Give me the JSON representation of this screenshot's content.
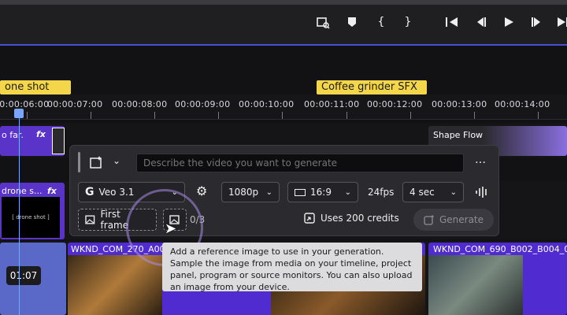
{
  "markers": {
    "left": "one shot",
    "right": "Coffee grinder SFX"
  },
  "ruler": [
    "00:00:06:00",
    "00:00:07:00",
    "00:00:08:00",
    "00:00:09:00",
    "00:00:10:00",
    "00:00:11:00",
    "00:00:12:00",
    "00:00:13:00",
    "00:00:14:00"
  ],
  "clips": {
    "top_left": "o far.",
    "top_right": "Shape Flow",
    "mid_left": "drone s...",
    "mid_left_inner": "[ drone shot ]",
    "bottom_left_time": "01:07",
    "bottom_clip1": "WKND_COM_270_A00",
    "bottom_clip2": "WKND_COM_690_B002_B004_0",
    "fx": "fx"
  },
  "panel": {
    "prompt_placeholder": "Describe the video you want to generate",
    "more": "…",
    "model": "Veo 3.1",
    "resolution": "1080p",
    "aspect": "16:9",
    "fps": "24fps",
    "duration": "4 sec",
    "first_frame": "First frame",
    "count": "0/3",
    "credits": "Uses 200 credits",
    "generate": "Generate"
  },
  "tooltip": "Add a reference image to use in your generation. Sample the image from media on your timeline, project panel, program or source monitors. You can also upload an image from your device.",
  "colors": {
    "accent": "#4a4fd8",
    "clip": "#5a33c9",
    "marker": "#f4d64a"
  }
}
